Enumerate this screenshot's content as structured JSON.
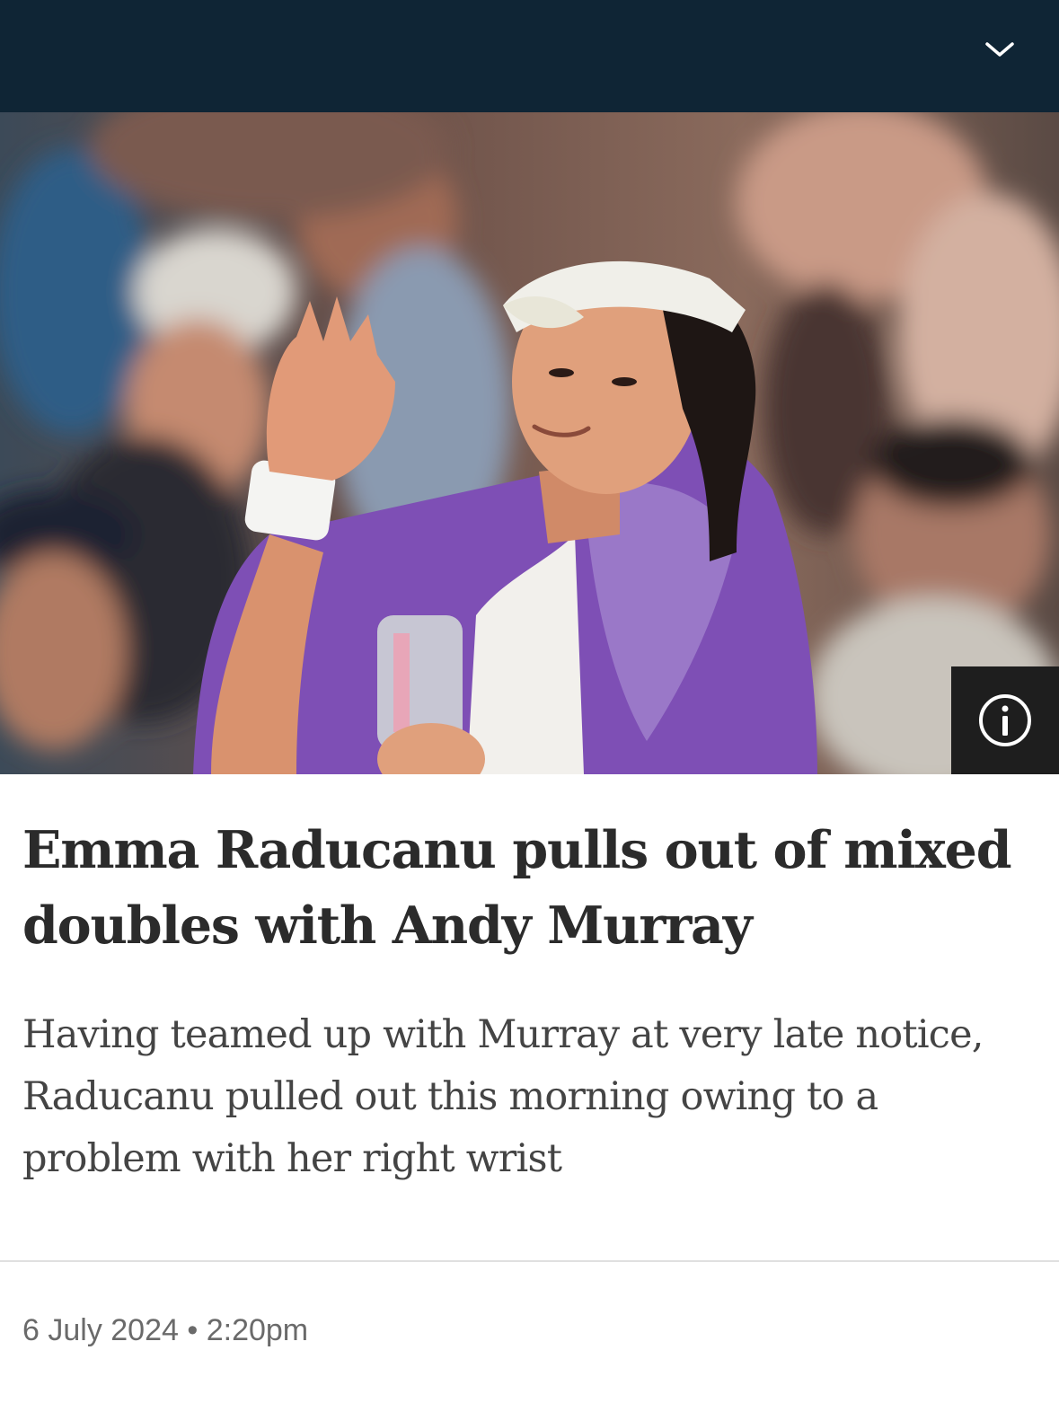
{
  "header": {
    "menu_icon": "chevron-down-icon",
    "background": "#0f2535"
  },
  "hero": {
    "info_icon": "info-icon"
  },
  "article": {
    "headline": "Emma Raducanu pulls out of mixed doubles with Andy Murray",
    "standfirst": "Having teamed up with Murray at very late notice, Raducanu pulled out this morning owing to a problem with her right wrist",
    "date": "6 July 2024",
    "separator": "•",
    "time": "2:20pm"
  }
}
